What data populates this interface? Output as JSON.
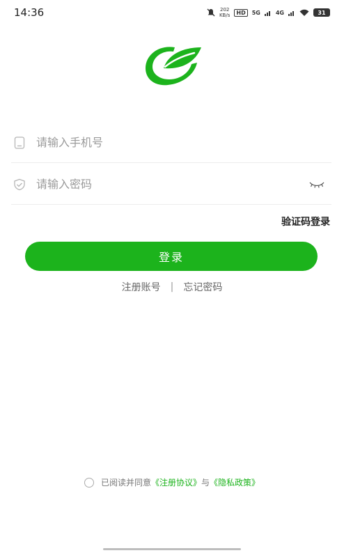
{
  "status_bar": {
    "time": "14:36",
    "net_speed_value": "202",
    "net_speed_unit": "KB/s",
    "hd_label": "HD",
    "signal_1": "5G",
    "signal_2": "4G",
    "battery": "31"
  },
  "form": {
    "phone_placeholder": "请输入手机号",
    "password_placeholder": "请输入密码",
    "sms_login_label": "验证码登录",
    "login_button_label": "登录"
  },
  "links": {
    "register": "注册账号",
    "separator": "|",
    "forgot_password": "忘记密码"
  },
  "agreement": {
    "prefix": "已阅读并同意",
    "user_agreement": "《注册协议》",
    "conjunction": "与",
    "privacy_policy": "《隐私政策》"
  },
  "colors": {
    "brand_green": "#1cb31c"
  }
}
